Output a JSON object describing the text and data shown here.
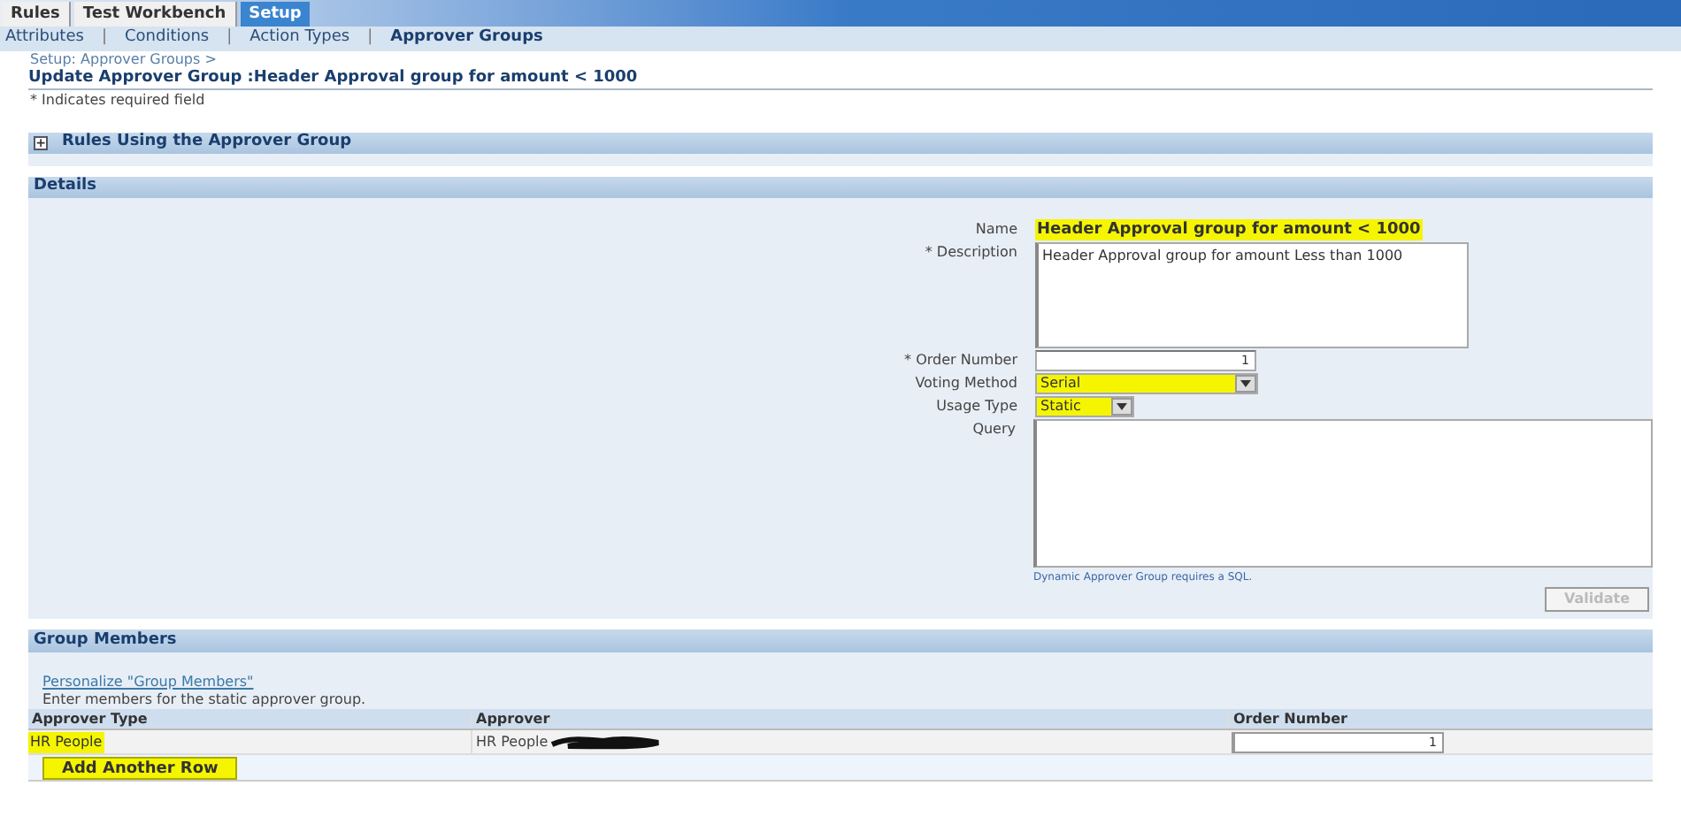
{
  "tabs": [
    {
      "label": "Rules",
      "selected": false
    },
    {
      "label": "Test Workbench",
      "selected": false
    },
    {
      "label": "Setup",
      "selected": true
    }
  ],
  "subtabs": [
    {
      "label": "Attributes",
      "selected": false
    },
    {
      "label": "Conditions",
      "selected": false
    },
    {
      "label": "Action Types",
      "selected": false
    },
    {
      "label": "Approver Groups",
      "selected": true
    }
  ],
  "subtab_separator": "|",
  "breadcrumb": "Setup: Approver Groups  >",
  "page_title": "Update Approver Group :Header Approval group for amount < 1000",
  "required_note": "* Indicates required field",
  "rules_section": {
    "title": "Rules Using the Approver Group",
    "expanded": false,
    "toggle": "+"
  },
  "details": {
    "title": "Details",
    "name": {
      "label": "Name",
      "value": "Header Approval group for amount < 1000",
      "highlighted": true
    },
    "description": {
      "label": "* Description",
      "value": "Header Approval group for amount Less than 1000"
    },
    "order_number": {
      "label": "* Order Number",
      "value": "1"
    },
    "voting_method": {
      "label": "Voting Method",
      "value": "Serial",
      "highlighted": true
    },
    "usage_type": {
      "label": "Usage Type",
      "value": "Static",
      "highlighted": true
    },
    "query": {
      "label": "Query",
      "hint": "Dynamic Approver Group requires a SQL."
    },
    "validate_button": {
      "label": "Validate",
      "disabled": true
    }
  },
  "group_members": {
    "title": "Group Members",
    "personalize_link": "Personalize \"Group Members\"",
    "instruction": "Enter members for the static approver group.",
    "columns": [
      "Approver Type",
      "Approver",
      "Order Number"
    ],
    "rows": [
      {
        "approver_type": "HR People",
        "approver_type_highlighted": true,
        "approver": "HR People",
        "order_number": "1"
      }
    ],
    "add_row_button": {
      "label": "Add Another Row",
      "highlighted": true
    }
  }
}
